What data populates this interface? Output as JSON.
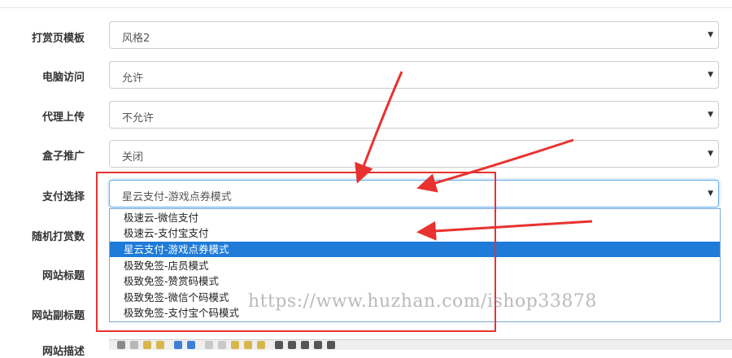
{
  "form": {
    "rows": [
      {
        "label": "打赏页模板",
        "value": "风格2"
      },
      {
        "label": "电脑访问",
        "value": "允许"
      },
      {
        "label": "代理上传",
        "value": "不允许"
      },
      {
        "label": "盒子推广",
        "value": "关闭"
      },
      {
        "label": "支付选择",
        "value": "星云支付-游戏点券模式"
      }
    ],
    "hidden_labels": [
      "随机打赏数",
      "网站标题",
      "网站副标题",
      "网站描述"
    ],
    "caret": "▼"
  },
  "dropdown": {
    "options": [
      "极速云-微信支付",
      "极速云-支付宝支付",
      "星云支付-游戏点券模式",
      "极致免签-店员模式",
      "极致免签-赞赏码模式",
      "极致免签-微信个码模式",
      "极致免签-支付宝个码模式"
    ],
    "selected_index": 2
  },
  "watermark": "https://www.huzhan.com/ishop33878",
  "colors": {
    "highlight": "#1e7bd8",
    "annotation_red": "#e8322f",
    "focus_border": "#66afe9"
  }
}
